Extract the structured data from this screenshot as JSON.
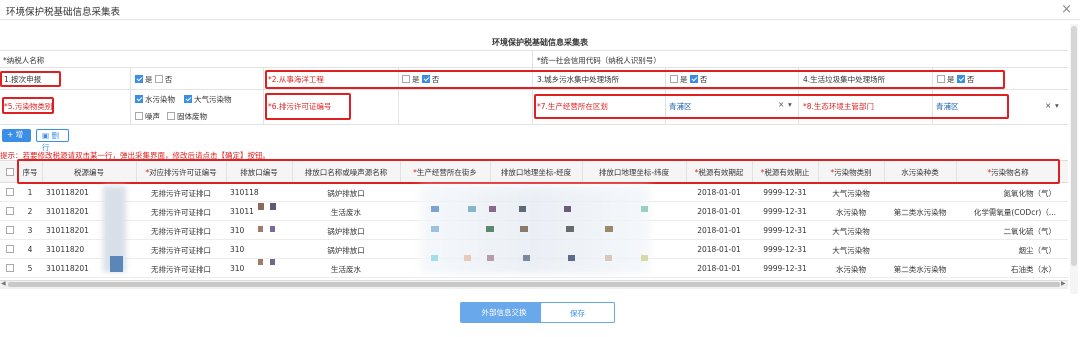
{
  "window": {
    "title": "环境保护税基础信息采集表",
    "close_glyph": "×"
  },
  "form": {
    "title": "环境保护税基础信息采集表",
    "taxpayer_name_label": "*纳税人名称",
    "credit_code_label": "*统一社会信用代码（纳税人识别号）",
    "yes": "是",
    "no": "否",
    "q1": "1.按次申报",
    "q2": "*2.从事海洋工程",
    "q3": "3.城乡污水集中处理场所",
    "q4": "4.生活垃圾集中处理场所",
    "q5": "*5.污染物类别",
    "pollutants": [
      "水污染物",
      "大气污染物",
      "噪声",
      "固体废物"
    ],
    "q6": "*6.排污许可证编号",
    "q7": "*7.生产经营所在区划",
    "q7_value": "青浦区",
    "q8": "*8.生态环境主管部门",
    "q8_value": "青浦区",
    "clear_glyph": "×",
    "caret_glyph": "▾"
  },
  "toolbar": {
    "add_label": "+ 增行",
    "delete_label": "删行"
  },
  "hint": "提示：若要修改税源请双击某一行，弹出采集界面，修改后请点击【确定】按钮。",
  "table": {
    "headers": [
      "序号",
      "税源编号",
      "*对应排污许可证编号",
      "排放口编号",
      "排放口名称或噪声源名称",
      "*生产经营所在街乡",
      "排放口地理坐标-经度",
      "排放口地理坐标-纬度",
      "*税源有效期起",
      "*税源有效期止",
      "*污染物类别",
      "水污染种类",
      "*污染物名称"
    ],
    "rows": [
      [
        "1",
        "310118201",
        "无排污许可证排口",
        "310118",
        "锅炉排放口",
        "",
        "",
        "",
        "2018-01-01",
        "9999-12-31",
        "大气污染物",
        "",
        "氮氧化物（气）"
      ],
      [
        "2",
        "310118201",
        "无排污许可证排口",
        "31011",
        "生活废水",
        "",
        "",
        "",
        "2018-01-01",
        "9999-12-31",
        "水污染物",
        "第二类水污染物",
        "化学需氧量(CODcr)（..."
      ],
      [
        "3",
        "310118201",
        "无排污许可证排口",
        "310",
        "锅炉排放口",
        "",
        "",
        "",
        "2018-01-01",
        "9999-12-31",
        "大气污染物",
        "",
        "二氧化硫（气）"
      ],
      [
        "4",
        "31011820",
        "无排污许可证排口",
        "310",
        "锅炉排放口",
        "",
        "",
        "",
        "2018-01-01",
        "9999-12-31",
        "大气污染物",
        "",
        "烟尘（气）"
      ],
      [
        "5",
        "310118201",
        "无排污许可证排口",
        "310",
        "生活废水",
        "",
        "",
        "",
        "2018-01-01",
        "9999-12-31",
        "水污染物",
        "第二类水污染物",
        "石油类（水）"
      ]
    ]
  },
  "footer": {
    "exchange_label": "外部信息交换",
    "save_label": "保存"
  },
  "colors": {
    "accent": "#3a8ee6",
    "highlight": "#e02020"
  }
}
